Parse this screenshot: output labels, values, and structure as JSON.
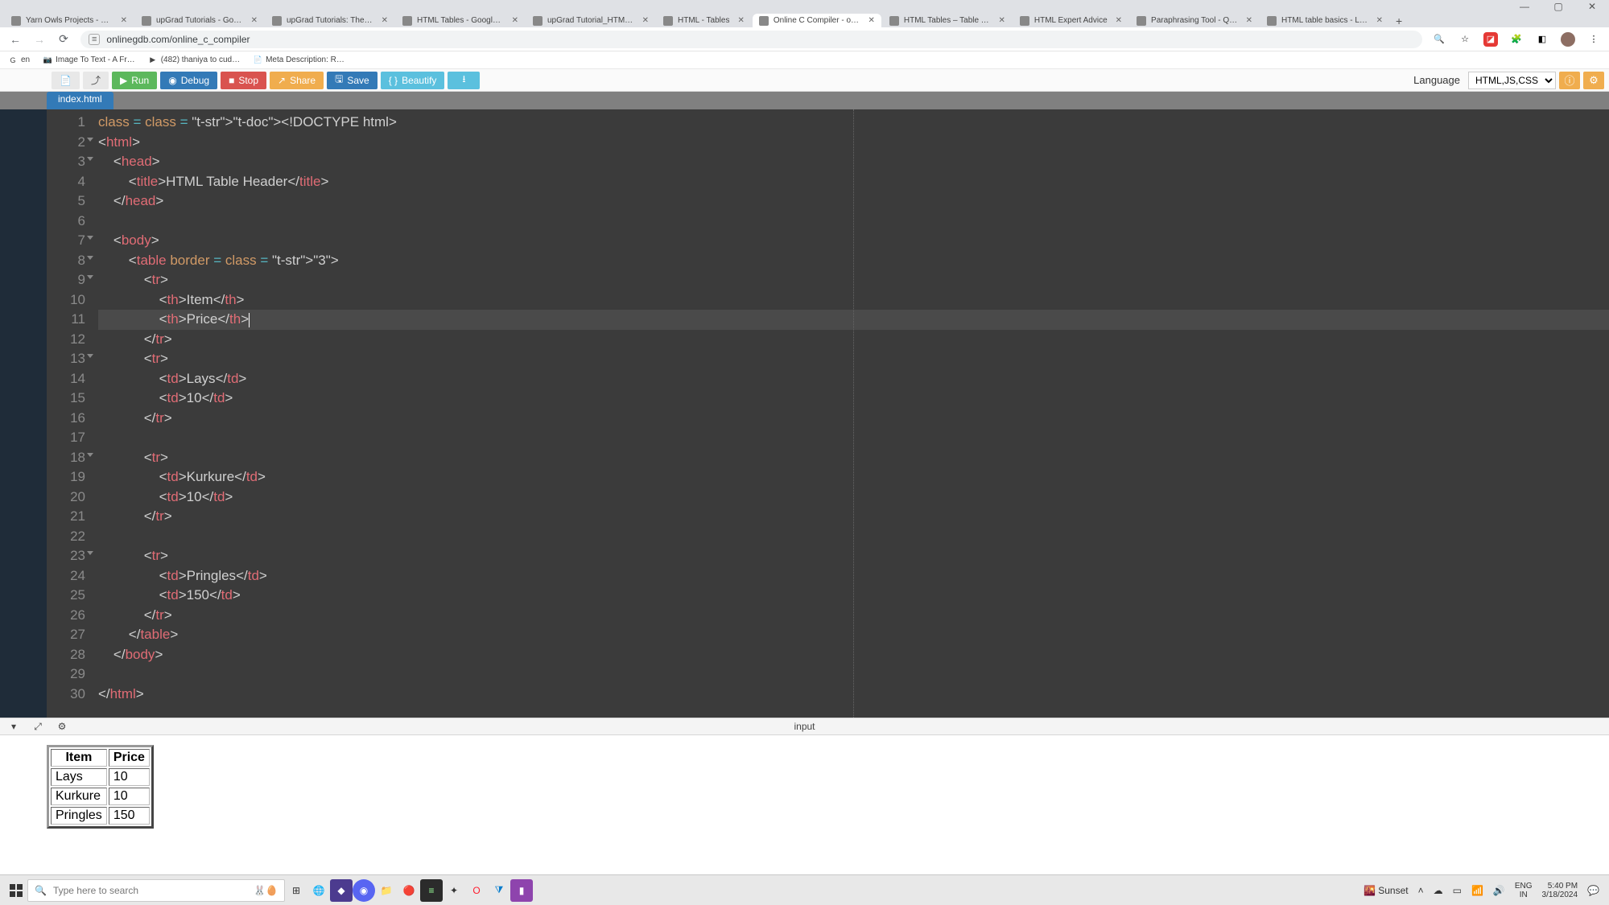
{
  "browser": {
    "tabs": [
      {
        "title": "Yarn Owls Projects - Goog",
        "fav": "c-green"
      },
      {
        "title": "upGrad Tutorials - Googl",
        "fav": "c-green"
      },
      {
        "title": "upGrad Tutorials: The Ult",
        "fav": "c-blue"
      },
      {
        "title": "HTML Tables - Google Do",
        "fav": "c-blue"
      },
      {
        "title": "upGrad Tutorial_HTML Ta",
        "fav": "c-blue"
      },
      {
        "title": "HTML - Tables",
        "fav": "c-teal"
      },
      {
        "title": "Online C Compiler - onlin",
        "fav": "c-purple",
        "active": true
      },
      {
        "title": "HTML Tables – Table Tuto",
        "fav": "c-dark"
      },
      {
        "title": "HTML Expert Advice",
        "fav": "c-teal"
      },
      {
        "title": "Paraphrasing Tool - Quill",
        "fav": "c-teal"
      },
      {
        "title": "HTML table basics - Learn",
        "fav": "c-dark"
      }
    ],
    "url": "onlinegdb.com/online_c_compiler",
    "bookmarks": [
      {
        "label": "en",
        "icon": "G"
      },
      {
        "label": "Image To Text - A Fr…",
        "icon": "📷"
      },
      {
        "label": "(482) thaniya to cud…",
        "icon": "▶"
      },
      {
        "label": "Meta Description: R…",
        "icon": "📄"
      }
    ]
  },
  "toolbar": {
    "run": "Run",
    "debug": "Debug",
    "stop": "Stop",
    "share": "Share",
    "save": "Save",
    "beautify": "Beautify",
    "language_label": "Language",
    "language_value": "HTML,JS,CSS"
  },
  "file_tab": "index.html",
  "code_lines": [
    "<!DOCTYPE html>",
    "<html>",
    "    <head>",
    "        <title>HTML Table Header</title>",
    "    </head>",
    "",
    "    <body>",
    "        <table border = \"3\">",
    "            <tr>",
    "                <th>Item</th>",
    "                <th>Price</th>",
    "            </tr>",
    "            <tr>",
    "                <td>Lays</td>",
    "                <td>10</td>",
    "            </tr>",
    "",
    "            <tr>",
    "                <td>Kurkure</td>",
    "                <td>10</td>",
    "            </tr>",
    "",
    "            <tr>",
    "                <td>Pringles</td>",
    "                <td>150</td>",
    "            </tr>",
    "        </table>",
    "    </body>",
    "",
    "</html>"
  ],
  "fold_lines": [
    2,
    3,
    7,
    8,
    9,
    13,
    18,
    23
  ],
  "current_line": 11,
  "panel_label": "input",
  "output_table": {
    "headers": [
      "Item",
      "Price"
    ],
    "rows": [
      [
        "Lays",
        "10"
      ],
      [
        "Kurkure",
        "10"
      ],
      [
        "Pringles",
        "150"
      ]
    ]
  },
  "taskbar": {
    "search_placeholder": "Type here to search",
    "weather": "Sunset",
    "lang1": "ENG",
    "lang2": "IN",
    "time": "5:40 PM",
    "date": "3/18/2024"
  }
}
